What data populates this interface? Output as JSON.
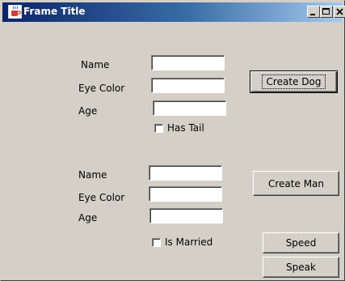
{
  "window": {
    "title": "Frame Title",
    "icon": "java-cup-icon"
  },
  "titlebar_buttons": {
    "minimize_icon": "minimize-icon",
    "maximize_icon": "maximize-icon",
    "close_icon": "close-icon"
  },
  "dog_form": {
    "name_label": "Name",
    "name_value": "",
    "eye_color_label": "Eye Color",
    "eye_color_value": "",
    "age_label": "Age",
    "age_value": "",
    "has_tail_label": "Has Tail",
    "has_tail_checked": false,
    "create_button": "Create Dog"
  },
  "man_form": {
    "name_label": "Name",
    "name_value": "",
    "eye_color_label": "Eye Color",
    "eye_color_value": "",
    "age_label": "Age",
    "age_value": "",
    "is_married_label": "Is Married",
    "is_married_checked": false,
    "create_button": "Create Man"
  },
  "actions": {
    "speed_button": "Speed",
    "speak_button": "Speak"
  },
  "colors": {
    "window_bg": "#d4d0c8",
    "titlebar_start": "#0a246a",
    "titlebar_end": "#a6caf0",
    "title_text": "#ffffff"
  }
}
